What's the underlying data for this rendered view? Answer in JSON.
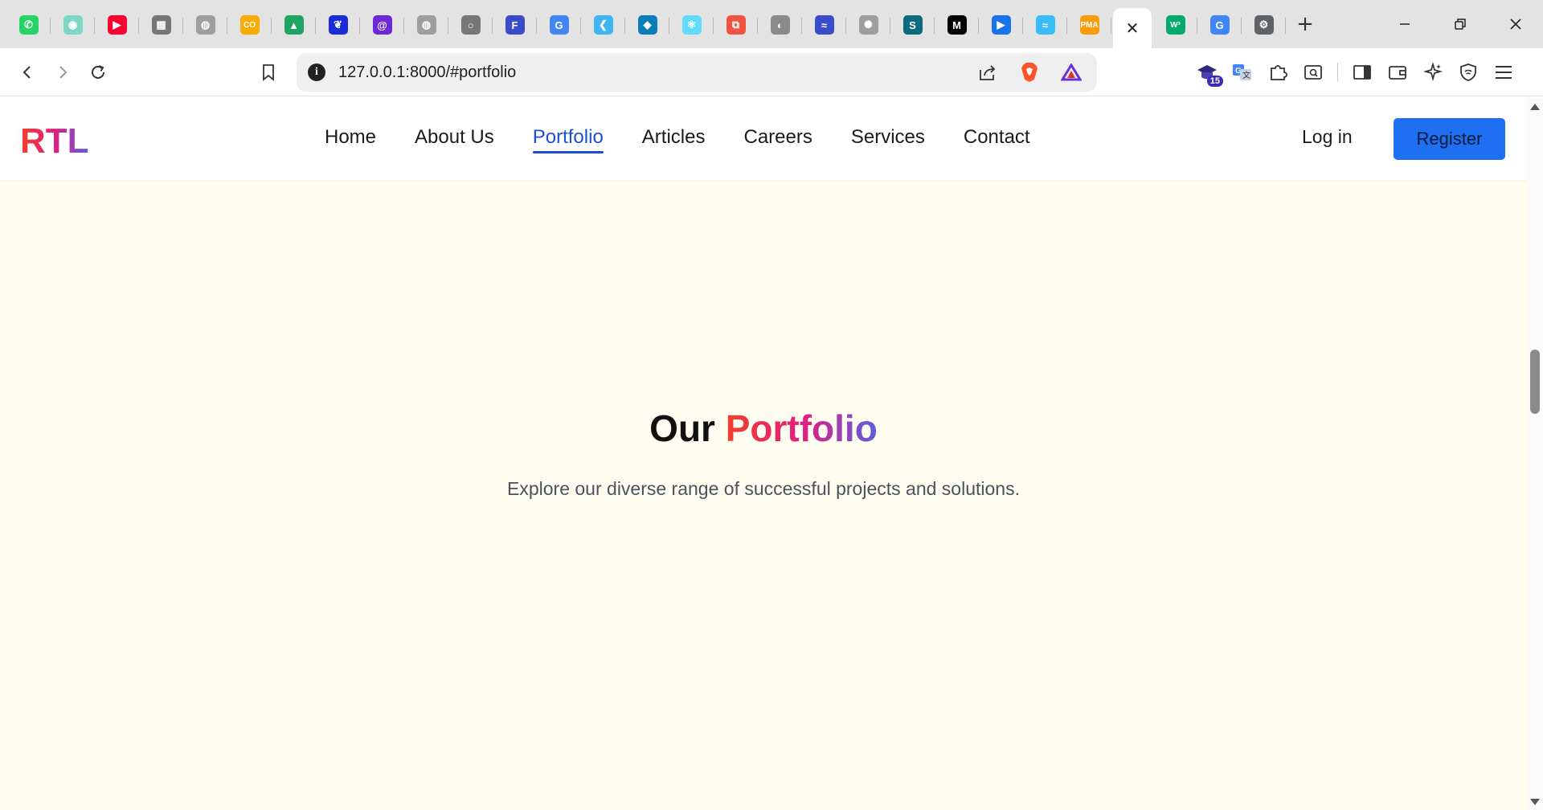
{
  "browser": {
    "tabs": [
      {
        "icon": "whatsapp-icon",
        "color": "#25d366",
        "glyph": "✆"
      },
      {
        "icon": "chat-bubble-icon",
        "color": "#7ed6c5",
        "glyph": "◉"
      },
      {
        "icon": "youtube-icon",
        "color": "#ff0033",
        "glyph": "▶"
      },
      {
        "icon": "gallery-icon",
        "color": "#777777",
        "glyph": "▦"
      },
      {
        "icon": "github-icon",
        "color": "#9e9e9e",
        "glyph": "◍"
      },
      {
        "icon": "colab-icon",
        "color": "#f9ab00",
        "glyph": "CO"
      },
      {
        "icon": "google-drive-icon",
        "color": "#1fa463",
        "glyph": "▲"
      },
      {
        "icon": "butterfly-icon",
        "color": "#1a2bd8",
        "glyph": "❦"
      },
      {
        "icon": "swirl-icon",
        "color": "#6d28d9",
        "glyph": "@"
      },
      {
        "icon": "github-icon",
        "color": "#9e9e9e",
        "glyph": "◍"
      },
      {
        "icon": "loading-circle-icon",
        "color": "#777777",
        "glyph": "○"
      },
      {
        "icon": "f-circle-icon",
        "color": "#3b4cca",
        "glyph": "F"
      },
      {
        "icon": "google-icon",
        "color": "#4285f4",
        "glyph": "G"
      },
      {
        "icon": "flutter-icon",
        "color": "#3fb6f3",
        "glyph": "❮"
      },
      {
        "icon": "dart-icon",
        "color": "#0b7db8",
        "glyph": "◆"
      },
      {
        "icon": "react-icon",
        "color": "#61dafb",
        "glyph": "⚛"
      },
      {
        "icon": "laravel-icon",
        "color": "#f05340",
        "glyph": "⧉"
      },
      {
        "icon": "globe-icon",
        "color": "#8a8a8a",
        "glyph": "◐"
      },
      {
        "icon": "wave-icon",
        "color": "#3b4cca",
        "glyph": "≈"
      },
      {
        "icon": "openai-icon",
        "color": "#9e9e9e",
        "glyph": "✺"
      },
      {
        "icon": "s-square-icon",
        "color": "#0e6b7e",
        "glyph": "S"
      },
      {
        "icon": "medium-icon",
        "color": "#000000",
        "glyph": "M"
      },
      {
        "icon": "play-circle-icon",
        "color": "#1a73e8",
        "glyph": "▶"
      },
      {
        "icon": "tailwind-icon",
        "color": "#38bdf8",
        "glyph": "≈"
      },
      {
        "icon": "phpmyadmin-icon",
        "color": "#f89c0e",
        "glyph": "PMA"
      },
      {
        "icon": "close-icon",
        "color": "#222222",
        "glyph": "✕",
        "active": true
      },
      {
        "icon": "w3schools-icon",
        "color": "#04aa6d",
        "glyph": "W³"
      },
      {
        "icon": "google-icon",
        "color": "#4285f4",
        "glyph": "G"
      },
      {
        "icon": "settings-gear-icon",
        "color": "#5f6368",
        "glyph": "⚙"
      }
    ],
    "new_tab_glyph": "+",
    "address": "127.0.0.1:8000/#portfolio",
    "extension_badge": "15"
  },
  "site": {
    "logo": "RTL",
    "nav": [
      {
        "label": "Home",
        "name": "nav-home"
      },
      {
        "label": "About Us",
        "name": "nav-about-us"
      },
      {
        "label": "Portfolio",
        "name": "nav-portfolio",
        "active": true
      },
      {
        "label": "Articles",
        "name": "nav-articles"
      },
      {
        "label": "Careers",
        "name": "nav-careers"
      },
      {
        "label": "Services",
        "name": "nav-services"
      },
      {
        "label": "Contact",
        "name": "nav-contact"
      }
    ],
    "login": "Log in",
    "register": "Register"
  },
  "section": {
    "title_plain": "Our",
    "title_highlight": "Portfolio",
    "subtitle": "Explore our diverse range of successful projects and solutions."
  },
  "colors": {
    "accent": "#1d4ed8",
    "button": "#1f6ff2",
    "section_bg": "#fefdef",
    "gradient": [
      "#f23f2c",
      "#e21e7c",
      "#5b5fe3"
    ]
  }
}
